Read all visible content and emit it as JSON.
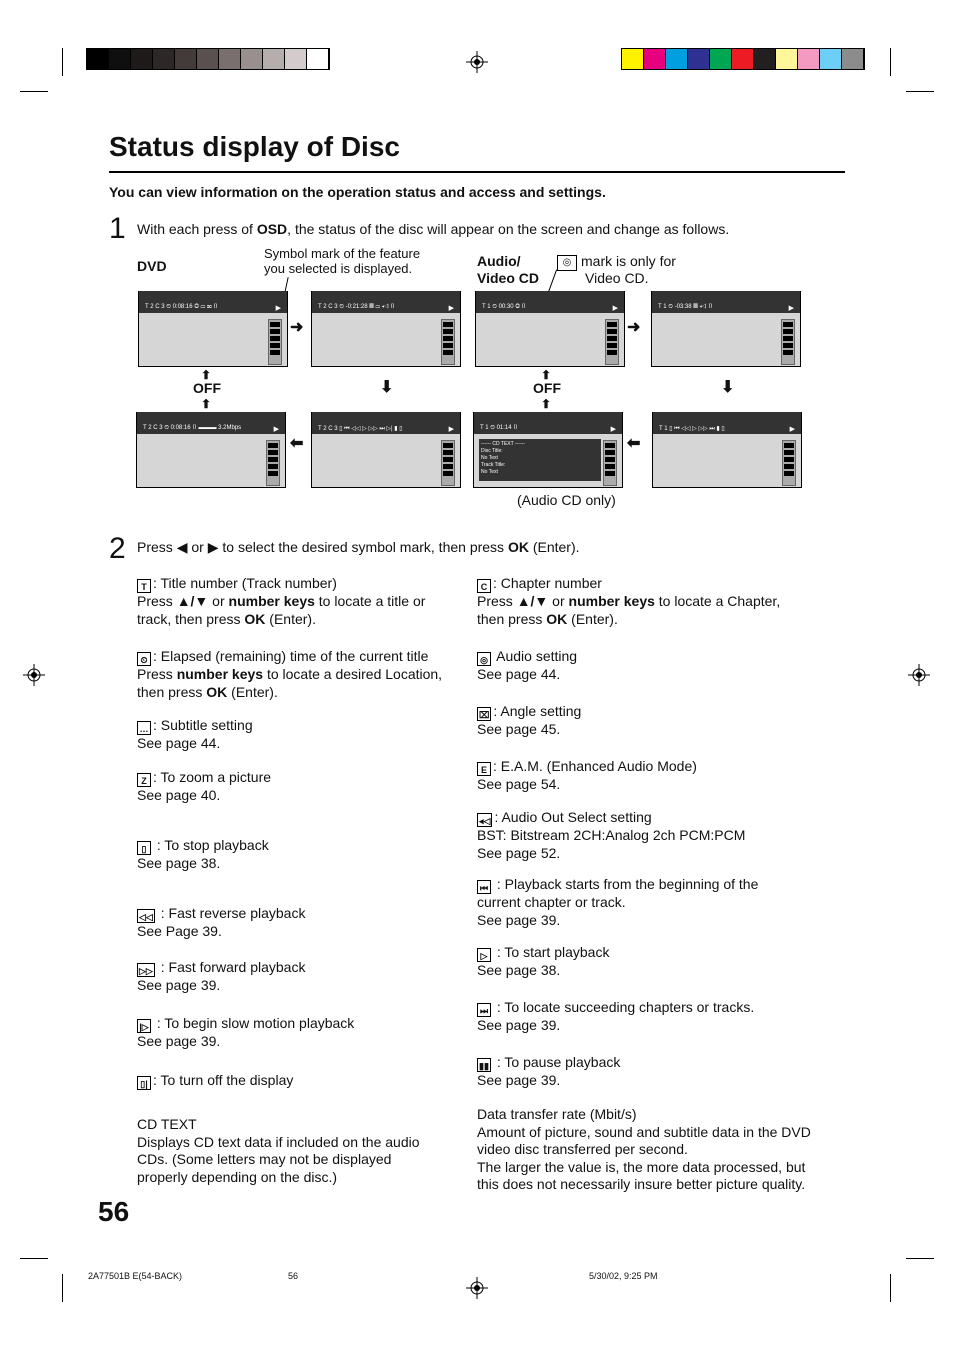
{
  "page": {
    "title": "Status display of Disc",
    "intro": "You can view information on the operation status and access and settings.",
    "page_number": "56"
  },
  "colors": {
    "gray_bars": [
      "#000000",
      "#0f0f0f",
      "#1e1a1a",
      "#2e2727",
      "#433a3a",
      "#5a5050",
      "#7a6f6f",
      "#9a8f8f",
      "#b6adad",
      "#d4cccc",
      "#ffffff"
    ],
    "color_bars": [
      "#fff200",
      "#e6007e",
      "#00a0e0",
      "#2e3192",
      "#00a651",
      "#ed1c24",
      "#231f20",
      "#fff799",
      "#f49ac1",
      "#6dcff6",
      "#8c8c8c"
    ]
  },
  "step1": {
    "num": "1",
    "pre": "With each press of ",
    "bold": "OSD",
    "post": ", the status of the disc will appear on the screen and change as follows."
  },
  "diagram": {
    "dvd_label": "DVD",
    "dvd_note_1": "Symbol mark of the feature",
    "dvd_note_2": "you selected is displayed.",
    "cd_label_1": "Audio/",
    "cd_label_2": "Video CD",
    "cd_note_1": "mark is only for",
    "cd_note_2": "Video CD.",
    "off": "OFF",
    "audio_cd_only": "(Audio CD only)",
    "screens": {
      "dvd1": "T 2  C 3  ⏲ 0:08:16  ◎ ▭ ⌧ ▯",
      "dvd2": "T 2  C 3  ⏲ -0:21:28  ▦ ▭ ◂◁ ▯",
      "dvd3": "T 2  C 3  ▯ ⏮ ◁◁ ▷ ▷▷ ⏭ ▷| ▮ ▯",
      "dvd4": "T 2  C 3  ⏲ 0:08:16  ▯  ▬▬▬ 3.2Mbps",
      "cd1": "T 1  ⏲  00:30  ◎  ▯",
      "cd2": "T 1  ⏲ -03:38      ▦ ◂◁ ▯",
      "cd3": "T 1  ▯ ⏮ ◁◁ ▷ ▷▷ ⏭ ▮ ▯",
      "cd4": "T 1  ⏲  01:14  ▯",
      "cd_text": [
        "------ CD TEXT ------",
        "Disc Title:",
        "No Text",
        "Track Title:",
        "No Text"
      ]
    }
  },
  "step2": {
    "num": "2",
    "pre": "Press ",
    "mid": " or ",
    "post": " to select the desired symbol mark, then press ",
    "ok": "OK",
    "end": " (Enter)."
  },
  "left_items": [
    {
      "icon": "T",
      "label": ": Title number (Track number)",
      "lines": [
        [
          {
            "t": "Press "
          },
          {
            "t": "▲/▼",
            "b": 1
          },
          {
            "t": " or "
          },
          {
            "t": "number keys",
            "b": 1
          },
          {
            "t": " to locate a title or"
          }
        ],
        [
          {
            "t": "track, then press "
          },
          {
            "t": "OK",
            "b": 1
          },
          {
            "t": " (Enter)."
          }
        ]
      ]
    },
    {
      "icon": "⏲",
      "label": ": Elapsed (remaining) time of the current title",
      "lines": [
        [
          {
            "t": "Press "
          },
          {
            "t": "number keys",
            "b": 1
          },
          {
            "t": " to locate a desired Location,"
          }
        ],
        [
          {
            "t": "then press "
          },
          {
            "t": "OK",
            "b": 1
          },
          {
            "t": " (Enter)."
          }
        ]
      ]
    },
    {
      "icon": "…",
      "label": ": Subtitle setting",
      "lines": [
        [
          {
            "t": "See page 44."
          }
        ]
      ]
    },
    {
      "icon": "Z",
      "label": ": To zoom a picture",
      "lines": [
        [
          {
            "t": "See page 40."
          }
        ]
      ]
    },
    {
      "icon": "▯",
      "label": " : To stop playback",
      "lines": [
        [
          {
            "t": "See page 38."
          }
        ]
      ]
    },
    {
      "icon": "◁◁",
      "label": " : Fast reverse playback",
      "lines": [
        [
          {
            "t": "See Page 39."
          }
        ]
      ]
    },
    {
      "icon": "▷▷",
      "label": " : Fast forward playback",
      "lines": [
        [
          {
            "t": "See page 39."
          }
        ]
      ]
    },
    {
      "icon": "|▷",
      "label": " : To begin slow motion playback",
      "lines": [
        [
          {
            "t": "See page 39."
          }
        ]
      ]
    },
    {
      "icon": "▯|",
      "label": ": To turn off the display",
      "lines": []
    },
    {
      "icon": "",
      "label": "CD TEXT",
      "lines": [
        [
          {
            "t": "Displays CD text data if included on the audio"
          }
        ],
        [
          {
            "t": "CDs. (Some letters may not be displayed"
          }
        ],
        [
          {
            "t": "properly depending on the disc.)"
          }
        ]
      ]
    }
  ],
  "right_items": [
    {
      "icon": "C",
      "label": ": Chapter number",
      "lines": [
        [
          {
            "t": "Press "
          },
          {
            "t": "▲/▼",
            "b": 1
          },
          {
            "t": " or "
          },
          {
            "t": "number keys",
            "b": 1
          },
          {
            "t": " to locate a Chapter,"
          }
        ],
        [
          {
            "t": "then press "
          },
          {
            "t": "OK",
            "b": 1
          },
          {
            "t": " (Enter)."
          }
        ]
      ]
    },
    {
      "icon": "◎",
      "label": " Audio setting",
      "lines": [
        [
          {
            "t": "See page 44."
          }
        ]
      ]
    },
    {
      "icon": "⌧",
      "label": ": Angle setting",
      "lines": [
        [
          {
            "t": "See page 45."
          }
        ]
      ]
    },
    {
      "icon": "E",
      "label": ": E.A.M. (Enhanced Audio Mode)",
      "lines": [
        [
          {
            "t": "See page 54."
          }
        ]
      ]
    },
    {
      "icon": "◂◁",
      "label": ": Audio Out Select setting",
      "lines": [
        [
          {
            "t": "BST: Bitstream 2CH:Analog 2ch PCM:PCM"
          }
        ],
        [
          {
            "t": "See page 52."
          }
        ]
      ]
    },
    {
      "icon": "⏮",
      "label": " : Playback starts from the beginning of the",
      "lines": [
        [
          {
            "t": "current chapter or track."
          }
        ],
        [
          {
            "t": "See page 39."
          }
        ]
      ]
    },
    {
      "icon": "▷",
      "label": " : To start playback",
      "lines": [
        [
          {
            "t": "See page 38."
          }
        ]
      ]
    },
    {
      "icon": "⏭",
      "label": " : To locate succeeding chapters or tracks.",
      "lines": [
        [
          {
            "t": "See page 39."
          }
        ]
      ]
    },
    {
      "icon": "▮▮",
      "label": " : To pause playback",
      "lines": [
        [
          {
            "t": "See page 39."
          }
        ]
      ]
    },
    {
      "icon": "",
      "label": "Data transfer rate (Mbit/s)",
      "lines": [
        [
          {
            "t": "Amount of picture, sound and subtitle data in the DVD"
          }
        ],
        [
          {
            "t": "video disc transferred per second."
          }
        ],
        [
          {
            "t": "The larger the value is, the more data processed, but"
          }
        ],
        [
          {
            "t": "this does not necessarily insure better picture quality."
          }
        ]
      ]
    }
  ],
  "footer": {
    "code": "2A77501B E(54-BACK)",
    "page": "56",
    "date": "5/30/02, 9:25 PM"
  }
}
